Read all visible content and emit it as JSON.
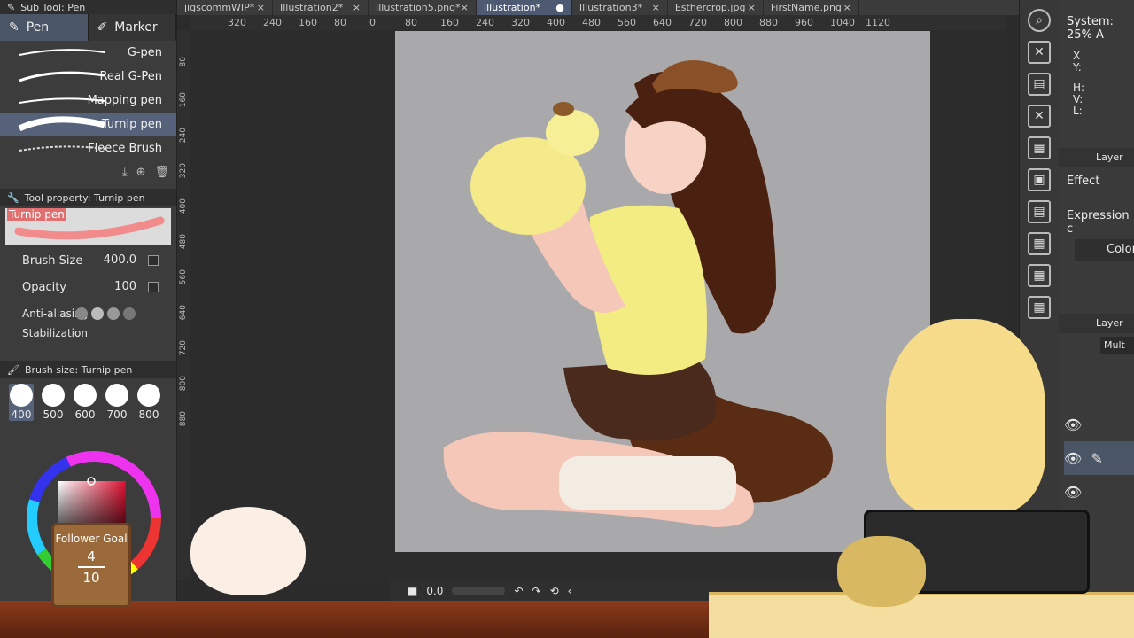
{
  "sub_tool": {
    "header": "Sub Tool: Pen",
    "tabs": [
      {
        "label": "Pen",
        "icon": "pen-icon"
      },
      {
        "label": "Marker",
        "icon": "marker-icon"
      }
    ],
    "brushes": [
      "G-pen",
      "Real G-Pen",
      "Mapping pen",
      "Turnip pen",
      "Fleece Brush"
    ],
    "selected_brush": "Turnip pen"
  },
  "tool_property": {
    "header": "Tool property: Turnip pen",
    "preview_label": "Turnip pen",
    "brush_size_label": "Brush Size",
    "brush_size_value": "400.0",
    "opacity_label": "Opacity",
    "opacity_value": "100",
    "antialiasing_label": "Anti-aliasing",
    "stabilization_label": "Stabilization"
  },
  "brush_size_panel": {
    "header": "Brush size: Turnip pen",
    "sizes": [
      "400",
      "500",
      "600",
      "700",
      "800"
    ],
    "selected": "400"
  },
  "doc_tabs": [
    {
      "label": "jigscommWIP*"
    },
    {
      "label": "Illustration2*"
    },
    {
      "label": "Illustration5.png*"
    },
    {
      "label": "Illustration*",
      "active": true
    },
    {
      "label": "Illustration3*"
    },
    {
      "label": "Esthercrop.jpg"
    },
    {
      "label": "FirstName.png"
    }
  ],
  "ruler_top": [
    "320",
    "240",
    "160",
    "80",
    "0",
    "80",
    "160",
    "240",
    "320",
    "400",
    "480",
    "560",
    "640",
    "720",
    "800",
    "880",
    "960",
    "1040",
    "1120"
  ],
  "ruler_left": [
    "80",
    "160",
    "240",
    "320",
    "400",
    "480",
    "560",
    "640",
    "720",
    "800",
    "880"
  ],
  "right_panel": {
    "system": "System: 25% A",
    "coords": [
      "X",
      "Y:",
      "H:",
      "V:",
      "L:"
    ],
    "layer_tab": "Layer",
    "effect": "Effect",
    "expression": "Expression c",
    "color_label": "Color",
    "layer_panel": "Layer",
    "blend": "Mult"
  },
  "navigator": {
    "value": "0.0"
  },
  "overlay": {
    "follower_goal": "Follower Goal",
    "current": "4",
    "target": "10"
  },
  "colors": {
    "accent": "#55627a",
    "canvas_bg": "#a9a9ab",
    "preview_stroke": "#f28b8b"
  }
}
